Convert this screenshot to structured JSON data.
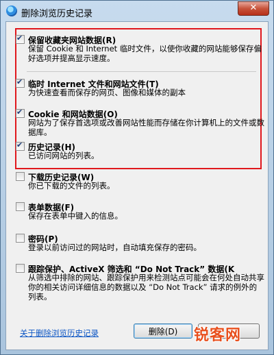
{
  "window": {
    "title": "删除浏览历史记录",
    "close_label": "✕"
  },
  "items": [
    {
      "label": "保留收藏夹网站数据(R)",
      "desc": "保留 Cookie 和 Internet 临时文件，以使你收藏的网站能够保存偏好选项并提高显示速度。",
      "checked": true
    },
    {
      "label": "临时 Internet 文件和网站文件(T)",
      "desc": "为快速查看而保存的网页、图像和媒体的副本",
      "checked": true
    },
    {
      "label": "Cookie 和网站数据(O)",
      "desc": "网站为了保存首选项或改善网站性能而存储在你计算机上的文件或数据库。",
      "checked": true
    },
    {
      "label": "历史记录(H)",
      "desc": "已访问网站的列表。",
      "checked": true
    },
    {
      "label": "下载历史记录(W)",
      "desc": "你已下载的文件的列表。",
      "checked": false
    },
    {
      "label": "表单数据(F)",
      "desc": "保存在表单中键入的信息。",
      "checked": false
    },
    {
      "label": "密码(P)",
      "desc": "登录以前访问过的网站时，自动填充保存的密码。",
      "checked": false
    },
    {
      "label": "跟踪保护、ActiveX 筛选和 “Do Not Track” 数据(K",
      "desc": "从筛选中排除的网站、跟踪保护用来检测站点可能会在何处自动共享你的相关访问详细信息的数据以及 “Do Not Track” 请求的例外的列表。",
      "checked": false
    }
  ],
  "footer": {
    "help_link": "关于删除浏览历史记录",
    "delete_label": "删除(D)",
    "watermark": "锐客网"
  }
}
